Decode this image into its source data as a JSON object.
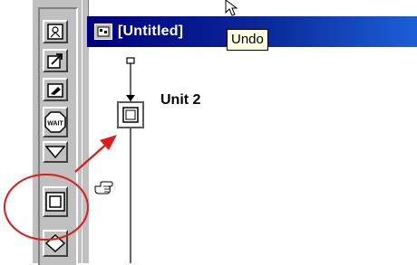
{
  "window": {
    "title": "[Untitled]"
  },
  "tooltip": {
    "text": "Undo"
  },
  "canvas": {
    "unit_label": "Unit 2"
  },
  "palette": {
    "tools": [
      {
        "name": "display-icon"
      },
      {
        "name": "interaction-icon"
      },
      {
        "name": "erase-icon"
      },
      {
        "name": "wait-icon",
        "label": "WAIT"
      },
      {
        "name": "decision-icon"
      },
      {
        "name": "map-icon"
      },
      {
        "name": "framework-icon"
      }
    ]
  },
  "colors": {
    "title_bar": "#000080",
    "annotation": "#e11919",
    "tooltip_bg": "#ffffe1",
    "chrome": "#c0c0c0"
  }
}
